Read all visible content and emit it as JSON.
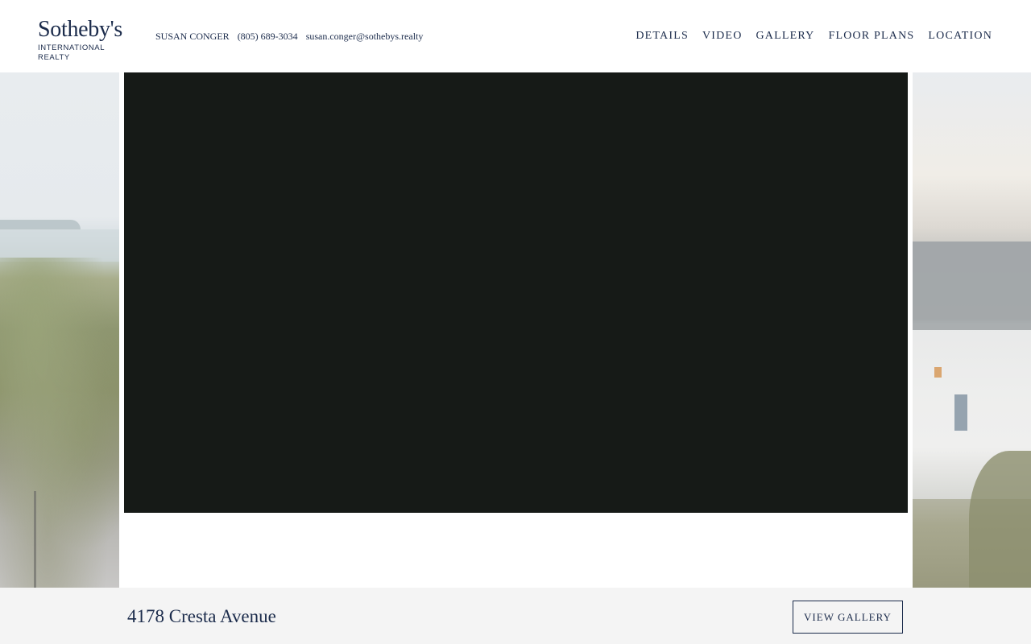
{
  "brand": {
    "logo_main": "Sotheby's",
    "logo_sub": "INTERNATIONAL REALTY"
  },
  "agent": {
    "name": "SUSAN CONGER",
    "phone": "(805) 689-3034",
    "email": "susan.conger@sothebys.realty"
  },
  "nav": {
    "items": [
      {
        "label": "DETAILS"
      },
      {
        "label": "VIDEO"
      },
      {
        "label": "GALLERY"
      },
      {
        "label": "FLOOR PLANS"
      },
      {
        "label": "LOCATION"
      }
    ]
  },
  "listing": {
    "address": "4178 Cresta Avenue",
    "gallery_button": "VIEW GALLERY"
  },
  "colors": {
    "brand_navy": "#1b2b4b",
    "video_bg": "#161a17",
    "footer_bg": "#f4f4f4"
  }
}
